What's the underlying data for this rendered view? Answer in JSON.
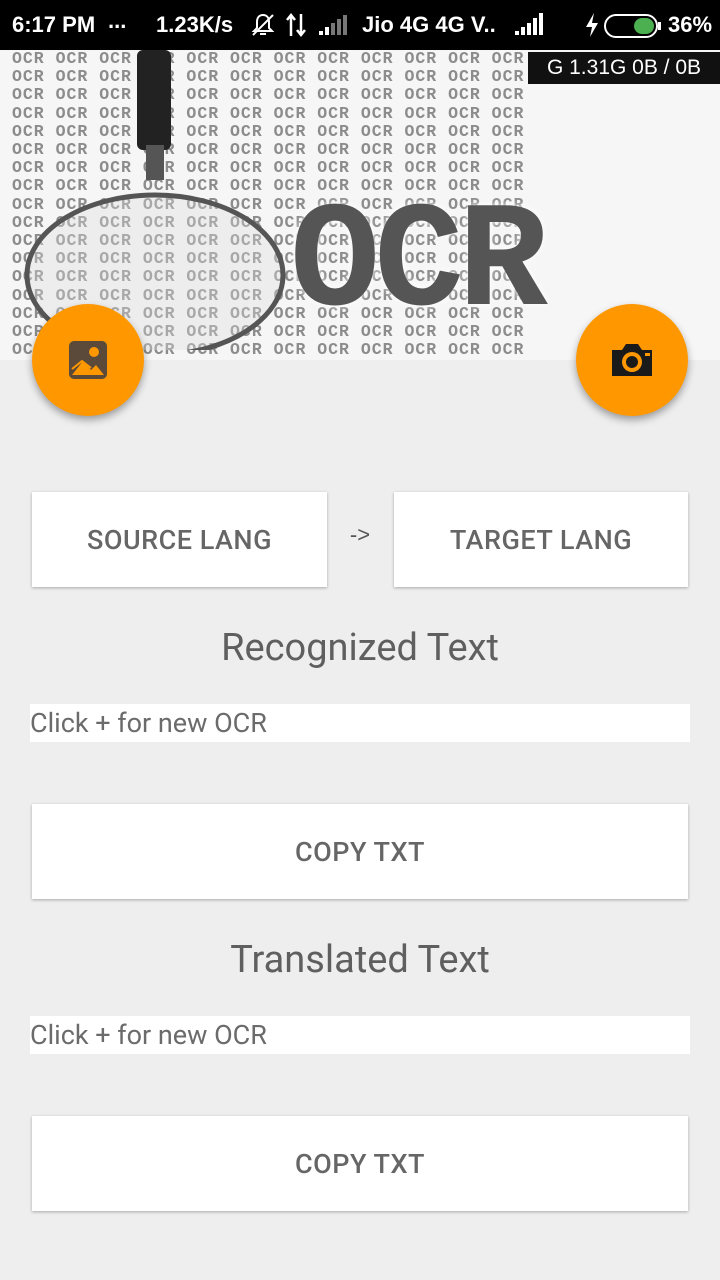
{
  "status_bar": {
    "time": "6:17 PM",
    "dots": "...",
    "speed": "1.23K/s",
    "carrier": "Jio 4G 4G V..",
    "battery": "36%"
  },
  "header": {
    "pattern_word": "OCR",
    "big_text": "OCR",
    "ram_overlay": "G 1.31G  0B / 0B"
  },
  "fab": {
    "gallery_icon": "image-icon",
    "camera_icon": "camera-icon"
  },
  "lang": {
    "source_label": "SOURCE LANG",
    "arrow": "->",
    "target_label": "TARGET LANG"
  },
  "recognized": {
    "heading": "Recognized Text",
    "text": "Click + for new OCR",
    "copy_label": "COPY TXT"
  },
  "translated": {
    "heading": "Translated Text",
    "text": "Click + for new OCR",
    "copy_label": "COPY TXT"
  },
  "colors": {
    "accent": "#ff9800",
    "background": "#eeeeee"
  }
}
